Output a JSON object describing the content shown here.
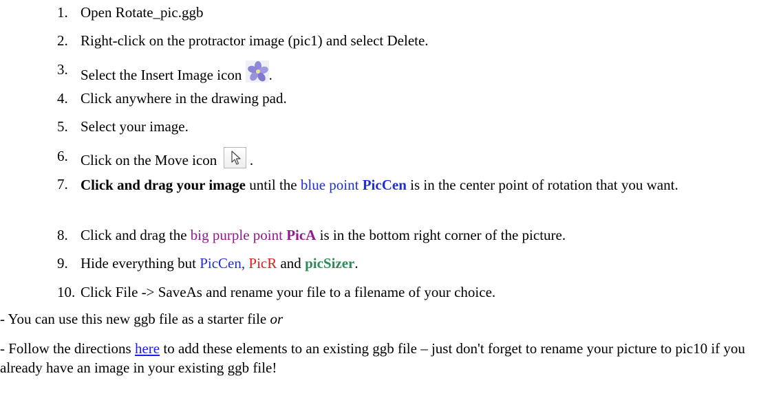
{
  "steps": [
    {
      "num": "1.",
      "text": "Open Rotate_pic.ggb"
    },
    {
      "num": "2.",
      "text": "Right-click on the protractor image (pic1) and select Delete."
    },
    {
      "num": "3.",
      "text_before": "Select the Insert Image icon",
      "text_after": "."
    },
    {
      "num": "4.",
      "text": "Click anywhere in the drawing pad."
    },
    {
      "num": "5.",
      "text": "Select your image."
    },
    {
      "num": "6.",
      "text_before": "Click on the Move icon",
      "text_after": "."
    },
    {
      "num": "7.",
      "bold_start": "Click and drag your image",
      "mid1": " until the ",
      "blue_text": "blue point ",
      "blue_bold": "PicCen",
      "mid2": " is in the center point of rotation that you want."
    },
    {
      "num": "8.",
      "before": "Click and drag the ",
      "purple_text": "big purple point ",
      "purple_bold": "PicA",
      "after": " is in the bottom right corner of the picture."
    },
    {
      "num": "9.",
      "before": "Hide everything but ",
      "blue_text": "PicCen,",
      "space": " ",
      "red_text": "PicR",
      "mid": " and ",
      "green_bold": "picSizer",
      "after": "."
    },
    {
      "num": "10.",
      "text": "Click File -> SaveAs and rename your file to a filename of your choice."
    }
  ],
  "para1": {
    "text": "- You can use this new ggb file as a starter file ",
    "italic": "or"
  },
  "para2": {
    "before": "- Follow the directions ",
    "link": "here",
    "after": " to add these elements to an existing ggb file – just don't forget to rename your picture to pic10 if you already have an image in your existing ggb file!"
  },
  "colors": {
    "blue": "#1f2ed6",
    "purple": "#8e1b8e",
    "red": "#e21b1b",
    "green": "#2e8b57",
    "link": "#1a1aff"
  },
  "icons": {
    "insert_image": "flower-image-icon",
    "move": "arrow-cursor-icon"
  }
}
